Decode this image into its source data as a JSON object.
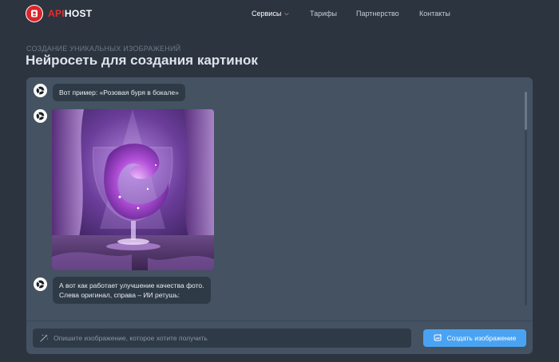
{
  "brand": {
    "api": "API",
    "host": "HOST"
  },
  "nav": {
    "items": [
      {
        "label": "Сервисы",
        "has_dropdown": true
      },
      {
        "label": "Тарифы"
      },
      {
        "label": "Партнерство"
      },
      {
        "label": "Контакты"
      }
    ]
  },
  "page": {
    "subtitle": "Создание уникальных изображений",
    "title": "Нейросеть для создания картинок"
  },
  "chat": {
    "messages": [
      {
        "text": "Вот пример: «Розовая буря в бокале»"
      },
      {
        "type": "image",
        "image_icon": "glass-with-pink-storm"
      },
      {
        "lines": [
          "А вот как работает улучшение качества фото.",
          "Слева оригинал, справа – ИИ ретушь:"
        ]
      }
    ]
  },
  "composer": {
    "placeholder": "Опишите изображение, которое хотите получить",
    "create_label": "Создать изображение"
  },
  "colors": {
    "background": "#2c3440",
    "panel": "#445262",
    "bubble": "#2f3a47",
    "accent": "#4aa3f2",
    "brand_red": "#d8262c"
  }
}
